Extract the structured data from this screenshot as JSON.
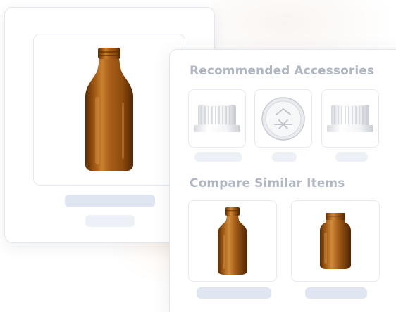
{
  "sections": {
    "accessories_title": "Recommended Accessories",
    "compare_title": "Compare Similar Items"
  },
  "product": {
    "image_icon": "amber-glass-bottle-icon"
  },
  "accessories": [
    {
      "icon": "white-screw-cap-icon"
    },
    {
      "icon": "tamper-evident-cap-top-icon"
    },
    {
      "icon": "white-screw-cap-icon"
    }
  ],
  "compare_items": [
    {
      "icon": "amber-round-bottle-icon"
    },
    {
      "icon": "amber-wide-mouth-jar-icon"
    }
  ],
  "colors": {
    "amber": "#8a4a0c",
    "amber_light": "#c57a2a",
    "cap_white": "#f3f4f6",
    "heading": "#b1b7c3",
    "placeholder_dark": "#dfe6f1",
    "placeholder_light": "#edf1f7"
  }
}
